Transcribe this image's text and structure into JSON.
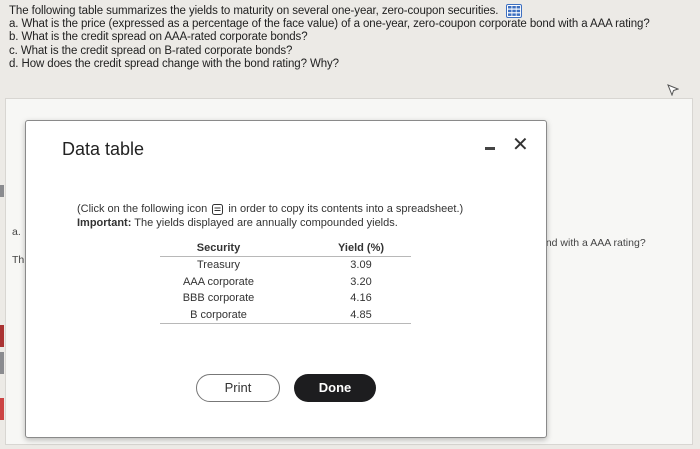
{
  "question": {
    "intro": "The following table summarizes the yields to maturity on several one-year, zero-coupon securities.",
    "a": "a. What is the price (expressed as a percentage of the face value) of a one-year, zero-coupon corporate bond with a AAA rating?",
    "b": "b. What is the credit spread on AAA-rated corporate bonds?",
    "c": "c. What is the credit spread on B-rated corporate bonds?",
    "d": "d. How does the credit spread change with the bond rating? Why?"
  },
  "background": {
    "label_a": "a.",
    "label_th": "Th",
    "right_text": "ond with a AAA rating?"
  },
  "dialog": {
    "title": "Data table",
    "minimize": "−",
    "close": "✕",
    "info_pre": "(Click on the following icon",
    "info_post": "in order to copy its contents into a spreadsheet.)",
    "important_label": "Important:",
    "important_text": "The yields displayed are annually compounded yields.",
    "table": {
      "headers": [
        "Security",
        "Yield (%)"
      ],
      "rows": [
        [
          "Treasury",
          "3.09"
        ],
        [
          "AAA corporate",
          "3.20"
        ],
        [
          "BBB corporate",
          "4.16"
        ],
        [
          "B corporate",
          "4.85"
        ]
      ]
    },
    "print_label": "Print",
    "done_label": "Done"
  },
  "icons": [
    "spreadsheet-grid-icon",
    "copy-icon",
    "mouse-cursor-icon"
  ],
  "colors": {
    "grid_icon": "#3d6fc0",
    "done_button": "#1d1d1f",
    "background": "#eceae6"
  }
}
